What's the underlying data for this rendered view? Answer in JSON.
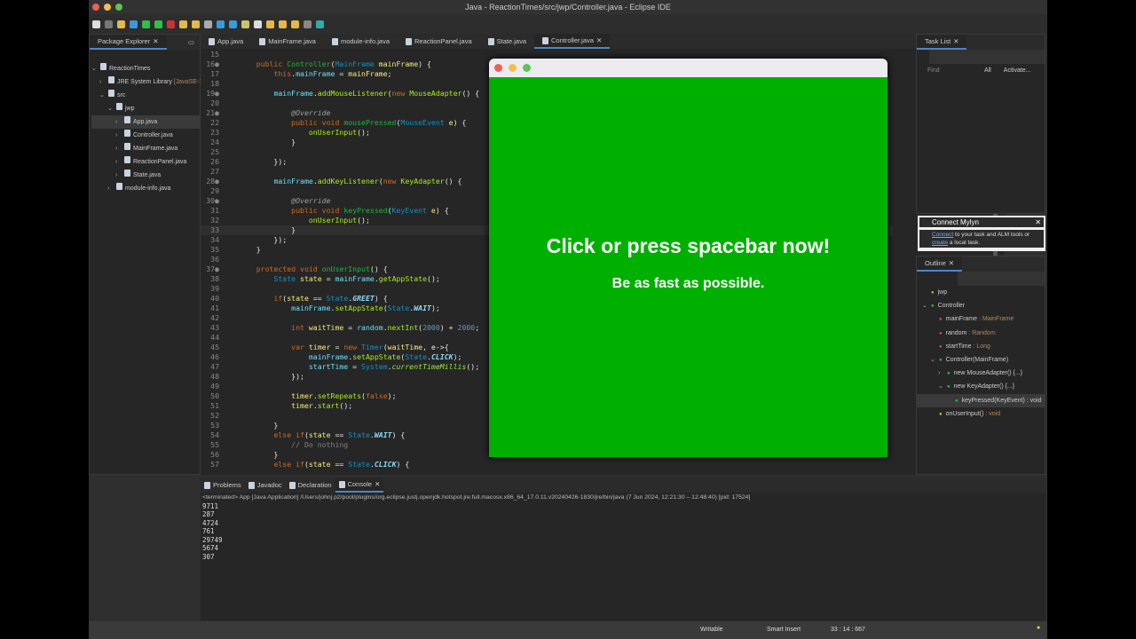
{
  "window": {
    "title": "Java - ReactionTimes/src/jwp/Controller.java - Eclipse IDE"
  },
  "package_explorer": {
    "title": "Package Explorer",
    "items": [
      {
        "label": "ReactionTimes",
        "indent": 0,
        "chev": "v"
      },
      {
        "label": "JRE System Library",
        "extra": "[JavaSE-17]",
        "indent": 1,
        "chev": ">"
      },
      {
        "label": "src",
        "indent": 1,
        "chev": "v"
      },
      {
        "label": "jwp",
        "indent": 2,
        "chev": "v"
      },
      {
        "label": "App.java",
        "indent": 3,
        "chev": ">",
        "selected": true
      },
      {
        "label": "Controller.java",
        "indent": 3,
        "chev": ">"
      },
      {
        "label": "MainFrame.java",
        "indent": 3,
        "chev": ">"
      },
      {
        "label": "ReactionPanel.java",
        "indent": 3,
        "chev": ">"
      },
      {
        "label": "State.java",
        "indent": 3,
        "chev": ">"
      },
      {
        "label": "module-info.java",
        "indent": 2,
        "chev": ">"
      }
    ]
  },
  "editor": {
    "tabs": [
      {
        "label": "App.java"
      },
      {
        "label": "MainFrame.java"
      },
      {
        "label": "module-info.java"
      },
      {
        "label": "ReactionPanel.java"
      },
      {
        "label": "State.java"
      },
      {
        "label": "Controller.java",
        "active": true
      }
    ],
    "lines": [
      {
        "n": "15",
        "t": []
      },
      {
        "n": "16●",
        "t": [
          [
            "pl",
            "    "
          ],
          [
            "kw",
            "public "
          ],
          [
            "md",
            "Controller"
          ],
          [
            "pl",
            "("
          ],
          [
            "ty",
            "MainFrame "
          ],
          [
            "lv",
            "mainFrame"
          ],
          [
            "pl",
            ") {"
          ]
        ]
      },
      {
        "n": "17",
        "t": [
          [
            "pl",
            "        "
          ],
          [
            "kw",
            "this"
          ],
          [
            "pl",
            "."
          ],
          [
            "fd",
            "mainFrame"
          ],
          [
            "pl",
            " = "
          ],
          [
            "lv",
            "mainFrame"
          ],
          [
            "pl",
            ";"
          ]
        ]
      },
      {
        "n": "18",
        "t": []
      },
      {
        "n": "19●",
        "t": [
          [
            "pl",
            "        "
          ],
          [
            "fd",
            "mainFrame"
          ],
          [
            "pl",
            "."
          ],
          [
            "mc",
            "addMouseListener"
          ],
          [
            "pl",
            "("
          ],
          [
            "kw",
            "new "
          ],
          [
            "mc",
            "MouseAdapter"
          ],
          [
            "pl",
            "() {"
          ]
        ]
      },
      {
        "n": "20",
        "t": []
      },
      {
        "n": "21●",
        "t": [
          [
            "pl",
            "            "
          ],
          [
            "an",
            "@Override"
          ]
        ]
      },
      {
        "n": "22",
        "t": [
          [
            "pl",
            "            "
          ],
          [
            "kw",
            "public void "
          ],
          [
            "md",
            "mousePressed"
          ],
          [
            "pl",
            "("
          ],
          [
            "ty",
            "MouseEvent "
          ],
          [
            "lv",
            "e"
          ],
          [
            "pl",
            ") {"
          ]
        ]
      },
      {
        "n": "23",
        "t": [
          [
            "pl",
            "                "
          ],
          [
            "mc",
            "onUserInput"
          ],
          [
            "pl",
            "();"
          ]
        ]
      },
      {
        "n": "24",
        "t": [
          [
            "pl",
            "            }"
          ]
        ]
      },
      {
        "n": "25",
        "t": []
      },
      {
        "n": "26",
        "t": [
          [
            "pl",
            "        });"
          ]
        ]
      },
      {
        "n": "27",
        "t": []
      },
      {
        "n": "28●",
        "t": [
          [
            "pl",
            "        "
          ],
          [
            "fd",
            "mainFrame"
          ],
          [
            "pl",
            "."
          ],
          [
            "mc",
            "addKeyListener"
          ],
          [
            "pl",
            "("
          ],
          [
            "kw",
            "new "
          ],
          [
            "mc",
            "KeyAdapter"
          ],
          [
            "pl",
            "() {"
          ]
        ]
      },
      {
        "n": "29",
        "t": []
      },
      {
        "n": "30●",
        "t": [
          [
            "pl",
            "            "
          ],
          [
            "an",
            "@Override"
          ]
        ]
      },
      {
        "n": "31",
        "t": [
          [
            "pl",
            "            "
          ],
          [
            "kw",
            "public void "
          ],
          [
            "md",
            "keyPressed"
          ],
          [
            "pl",
            "("
          ],
          [
            "ty",
            "KeyEvent "
          ],
          [
            "lv",
            "e"
          ],
          [
            "pl",
            ") {"
          ]
        ]
      },
      {
        "n": "32",
        "t": [
          [
            "pl",
            "                "
          ],
          [
            "mc",
            "onUserInput"
          ],
          [
            "pl",
            "();"
          ]
        ]
      },
      {
        "n": "33",
        "t": [
          [
            "pl",
            "            }"
          ]
        ],
        "current": true
      },
      {
        "n": "34",
        "t": [
          [
            "pl",
            "        });"
          ]
        ]
      },
      {
        "n": "35",
        "t": [
          [
            "pl",
            "    }"
          ]
        ]
      },
      {
        "n": "36",
        "t": []
      },
      {
        "n": "37●",
        "t": [
          [
            "pl",
            "    "
          ],
          [
            "kw",
            "protected void "
          ],
          [
            "md",
            "onUserInput"
          ],
          [
            "pl",
            "() {"
          ]
        ]
      },
      {
        "n": "38",
        "t": [
          [
            "pl",
            "        "
          ],
          [
            "ty",
            "State "
          ],
          [
            "lv",
            "state"
          ],
          [
            "pl",
            " = "
          ],
          [
            "fd",
            "mainFrame"
          ],
          [
            "pl",
            "."
          ],
          [
            "mc",
            "getAppState"
          ],
          [
            "pl",
            "();"
          ]
        ]
      },
      {
        "n": "39",
        "t": []
      },
      {
        "n": "40",
        "t": [
          [
            "pl",
            "        "
          ],
          [
            "kw",
            "if"
          ],
          [
            "pl",
            "("
          ],
          [
            "lv",
            "state"
          ],
          [
            "pl",
            " == "
          ],
          [
            "ty",
            "State"
          ],
          [
            "pl",
            "."
          ],
          [
            "en",
            "GREET"
          ],
          [
            "pl",
            ") {"
          ]
        ]
      },
      {
        "n": "41",
        "t": [
          [
            "pl",
            "            "
          ],
          [
            "fd",
            "mainFrame"
          ],
          [
            "pl",
            "."
          ],
          [
            "mc",
            "setAppState"
          ],
          [
            "pl",
            "("
          ],
          [
            "ty",
            "State"
          ],
          [
            "pl",
            "."
          ],
          [
            "en",
            "WAIT"
          ],
          [
            "pl",
            ");"
          ]
        ]
      },
      {
        "n": "42",
        "t": []
      },
      {
        "n": "43",
        "t": [
          [
            "pl",
            "            "
          ],
          [
            "kw",
            "int "
          ],
          [
            "lv",
            "waitTime"
          ],
          [
            "pl",
            " = "
          ],
          [
            "fd",
            "random"
          ],
          [
            "pl",
            "."
          ],
          [
            "mc",
            "nextInt"
          ],
          [
            "pl",
            "("
          ],
          [
            "nu",
            "2000"
          ],
          [
            "pl",
            ") + "
          ],
          [
            "nu",
            "2000"
          ],
          [
            "pl",
            ";"
          ]
        ]
      },
      {
        "n": "44",
        "t": []
      },
      {
        "n": "45",
        "t": [
          [
            "pl",
            "            "
          ],
          [
            "kw",
            "var "
          ],
          [
            "lv",
            "timer"
          ],
          [
            "pl",
            " = "
          ],
          [
            "kw",
            "new "
          ],
          [
            "ty",
            "Timer"
          ],
          [
            "pl",
            "("
          ],
          [
            "lv",
            "waitTime"
          ],
          [
            "pl",
            ", e->{"
          ]
        ]
      },
      {
        "n": "46",
        "t": [
          [
            "pl",
            "                "
          ],
          [
            "fd",
            "mainFrame"
          ],
          [
            "pl",
            "."
          ],
          [
            "mc",
            "setAppState"
          ],
          [
            "pl",
            "("
          ],
          [
            "ty",
            "State"
          ],
          [
            "pl",
            "."
          ],
          [
            "en",
            "CLICK"
          ],
          [
            "pl",
            ");"
          ]
        ]
      },
      {
        "n": "47",
        "t": [
          [
            "pl",
            "                "
          ],
          [
            "fd",
            "startTime"
          ],
          [
            "pl",
            " = "
          ],
          [
            "ty",
            "System"
          ],
          [
            "pl",
            "."
          ],
          [
            "st",
            "currentTimeMillis"
          ],
          [
            "pl",
            "();"
          ]
        ]
      },
      {
        "n": "48",
        "t": [
          [
            "pl",
            "            });"
          ]
        ]
      },
      {
        "n": "49",
        "t": []
      },
      {
        "n": "50",
        "t": [
          [
            "pl",
            "            "
          ],
          [
            "lv",
            "timer"
          ],
          [
            "pl",
            "."
          ],
          [
            "mc",
            "setRepeats"
          ],
          [
            "pl",
            "("
          ],
          [
            "kw",
            "false"
          ],
          [
            "pl",
            ");"
          ]
        ]
      },
      {
        "n": "51",
        "t": [
          [
            "pl",
            "            "
          ],
          [
            "lv",
            "timer"
          ],
          [
            "pl",
            "."
          ],
          [
            "mc",
            "start"
          ],
          [
            "pl",
            "();"
          ]
        ]
      },
      {
        "n": "52",
        "t": []
      },
      {
        "n": "53",
        "t": [
          [
            "pl",
            "        }"
          ]
        ]
      },
      {
        "n": "54",
        "t": [
          [
            "pl",
            "        "
          ],
          [
            "kw",
            "else if"
          ],
          [
            "pl",
            "("
          ],
          [
            "lv",
            "state"
          ],
          [
            "pl",
            " == "
          ],
          [
            "ty",
            "State"
          ],
          [
            "pl",
            "."
          ],
          [
            "en",
            "WAIT"
          ],
          [
            "pl",
            ") {"
          ]
        ]
      },
      {
        "n": "55",
        "t": [
          [
            "pl",
            "            "
          ],
          [
            "cm",
            "// Do nothing"
          ]
        ]
      },
      {
        "n": "56",
        "t": [
          [
            "pl",
            "        }"
          ]
        ]
      },
      {
        "n": "57",
        "t": [
          [
            "pl",
            "        "
          ],
          [
            "kw",
            "else if"
          ],
          [
            "pl",
            "("
          ],
          [
            "lv",
            "state"
          ],
          [
            "pl",
            " == "
          ],
          [
            "ty",
            "State"
          ],
          [
            "pl",
            "."
          ],
          [
            "en",
            "CLICK"
          ],
          [
            "pl",
            ") {"
          ]
        ]
      }
    ]
  },
  "app_window": {
    "background": "#00b000",
    "heading": "Click or press spacebar now!",
    "subheading": "Be as fast as possible."
  },
  "task_list": {
    "title": "Task List",
    "find_placeholder": "Find",
    "all": "All",
    "activate": "Activate..."
  },
  "mylyn": {
    "title": "Connect Mylyn",
    "link1": "Connect",
    "text1": " to your task and ALM tools or",
    "link2": "create",
    "text2": " a local task."
  },
  "outline": {
    "title": "Outline",
    "items": [
      {
        "label": "jwp",
        "type": "",
        "indent": 0
      },
      {
        "label": "Controller",
        "type": "",
        "indent": 0,
        "chev": "v"
      },
      {
        "label": "mainFrame",
        "type": " : MainFrame",
        "indent": 1
      },
      {
        "label": "random",
        "type": " : Random",
        "indent": 1
      },
      {
        "label": "startTime",
        "type": " : Long",
        "indent": 1
      },
      {
        "label": "Controller(MainFrame)",
        "type": "",
        "indent": 1,
        "chev": "v"
      },
      {
        "label": "new MouseAdapter() {...}",
        "type": "",
        "indent": 2,
        "chev": ">"
      },
      {
        "label": "new KeyAdapter() {...}",
        "type": "",
        "indent": 2,
        "chev": "v"
      },
      {
        "label": "keyPressed(KeyEvent) : void",
        "type": "",
        "indent": 3,
        "selected": true
      },
      {
        "label": "onUserInput()",
        "type": " : void",
        "indent": 1
      }
    ]
  },
  "bottom": {
    "tabs": [
      {
        "label": "Problems"
      },
      {
        "label": "Javadoc"
      },
      {
        "label": "Declaration"
      },
      {
        "label": "Console",
        "active": true
      }
    ],
    "console_header": "<terminated> App [Java Application] /Users/johnj.p2/pool/plugins/org.eclipse.justj.openjdk.hotspot.jre.full.macosx.x86_64_17.0.11.v20240426-1830/jre/bin/java  (7 Jun 2024, 12:21:30 – 12:48:40) [pid: 17524]",
    "output": [
      "9711",
      "287",
      "4724",
      "761",
      "29749",
      "5674",
      "307"
    ]
  },
  "status": {
    "writable": "Writable",
    "insert": "Smart Insert",
    "position": "33 : 14 : 667"
  }
}
